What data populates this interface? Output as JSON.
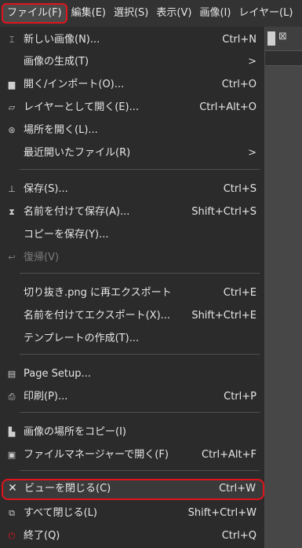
{
  "menubar": {
    "items": [
      {
        "label": "ファイル(F)"
      },
      {
        "label": "編集(E)"
      },
      {
        "label": "選択(S)"
      },
      {
        "label": "表示(V)"
      },
      {
        "label": "画像(I)"
      },
      {
        "label": "レイヤー(L)"
      }
    ]
  },
  "background": {
    "close_glyph": "⊠"
  },
  "menu": {
    "submenu_arrow": ">",
    "items": [
      {
        "label": "新しい画像(N)...",
        "shortcut": "Ctrl+N",
        "icon": "new-image-icon",
        "glyph": "⌶"
      },
      {
        "label": "画像の生成(T)",
        "icon": "none"
      },
      {
        "label": "開く/インポート(O)...",
        "shortcut": "Ctrl+O",
        "icon": "open-icon",
        "glyph": "▆"
      },
      {
        "label": "レイヤーとして開く(E)...",
        "shortcut": "Ctrl+Alt+O",
        "icon": "open-layer-icon",
        "glyph": "▱"
      },
      {
        "label": "場所を開く(L)...",
        "icon": "globe-icon",
        "glyph": "⊛"
      },
      {
        "label": "最近開いたファイル(R)",
        "icon": "none"
      },
      {
        "label": "保存(S)...",
        "shortcut": "Ctrl+S",
        "icon": "save-icon",
        "glyph": "⊥"
      },
      {
        "label": "名前を付けて保存(A)...",
        "shortcut": "Shift+Ctrl+S",
        "icon": "save-as-icon",
        "glyph": "⧗"
      },
      {
        "label": "コピーを保存(Y)...",
        "icon": "none"
      },
      {
        "label": "復帰(V)",
        "icon": "revert-icon",
        "glyph": "↩",
        "disabled": true
      },
      {
        "label": "切り抜き.png に再エクスポート",
        "shortcut": "Ctrl+E",
        "icon": "none"
      },
      {
        "label": "名前を付けてエクスポート(X)...",
        "shortcut": "Shift+Ctrl+E",
        "icon": "none"
      },
      {
        "label": "テンプレートの作成(T)...",
        "icon": "none"
      },
      {
        "label": "Page Setup...",
        "icon": "page-setup-icon",
        "glyph": "▤"
      },
      {
        "label": "印刷(P)...",
        "shortcut": "Ctrl+P",
        "icon": "print-icon",
        "glyph": "⎙"
      },
      {
        "label": "画像の場所をコピー(I)",
        "icon": "copy-location-icon",
        "glyph": "▙"
      },
      {
        "label": "ファイルマネージャーで開く(F)",
        "shortcut": "Ctrl+Alt+F",
        "icon": "file-manager-icon",
        "glyph": "▣"
      },
      {
        "label": "ビューを閉じる(C)",
        "shortcut": "Ctrl+W",
        "icon": "close-icon",
        "glyph": "✕"
      },
      {
        "label": "すべて閉じる(L)",
        "shortcut": "Shift+Ctrl+W",
        "icon": "close-all-icon",
        "glyph": "⧉"
      },
      {
        "label": "終了(Q)",
        "shortcut": "Ctrl+Q",
        "icon": "quit-icon",
        "glyph": "⏻"
      }
    ]
  },
  "colors": {
    "highlight_border": "#e0141c",
    "menu_bg": "#2b2b2b",
    "text": "#e6e6e6"
  }
}
